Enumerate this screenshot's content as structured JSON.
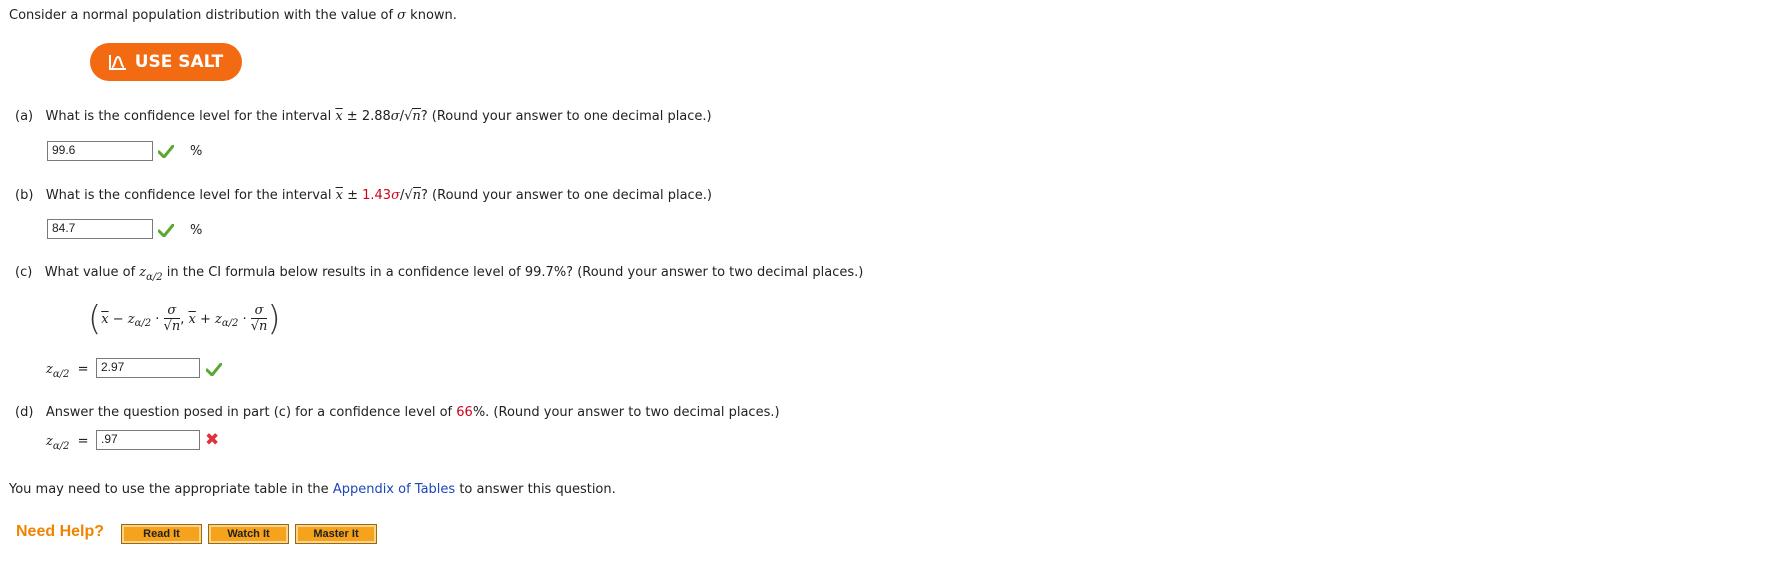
{
  "intro": {
    "prefix": "Consider a normal population distribution with the value of ",
    "sigma": "σ",
    "suffix": " known."
  },
  "salt_button": {
    "label": "USE SALT",
    "color": "#f26a12"
  },
  "part_a": {
    "label": "(a)",
    "q_prefix": "What is the confidence level for the interval ",
    "xbar": "x",
    "pm": " ± ",
    "coef": "2.88",
    "sigma": "σ",
    "slash": "/",
    "sqrt_sym": "√",
    "n": "n",
    "q_suffix": "? (Round your answer to one decimal place.)",
    "answer": "99.6",
    "unit": "%"
  },
  "part_b": {
    "label": "(b)",
    "q_prefix": "What is the confidence level for the interval ",
    "xbar": "x",
    "pm": " ± ",
    "coef": "1.43",
    "sigma": "σ",
    "slash": "/",
    "sqrt_sym": "√",
    "n": "n",
    "q_suffix": "? (Round your answer to one decimal place.)",
    "answer": "84.7",
    "unit": "%"
  },
  "part_c": {
    "label": "(c)",
    "q_prefix": "What value of ",
    "z": "z",
    "z_sub": "α/2",
    "q_suffix": " in the CI formula below results in a confidence level of 99.7%? (Round your answer to two decimal places.)",
    "formula": {
      "open": "(",
      "close": ")",
      "xbar": "x",
      "minus": " − ",
      "plus": " + ",
      "z": "z",
      "z_sub": "α/2",
      "dot": " · ",
      "sigma": "σ",
      "sqrt_sym": "√",
      "n": "n",
      "comma": ", "
    },
    "answer_label_z": "z",
    "answer_label_sub": "α/2",
    "equals": "=",
    "answer": "2.97"
  },
  "part_d": {
    "label": "(d)",
    "q_prefix": "Answer the question posed in part (c) for a confidence level of ",
    "level": "66",
    "q_suffix": "%. (Round your answer to two decimal places.)",
    "answer_label_z": "z",
    "answer_label_sub": "α/2",
    "equals": "=",
    "answer": ".97"
  },
  "footer": {
    "prefix": "You may need to use the appropriate table in the ",
    "link": "Appendix of Tables",
    "suffix": " to answer this question."
  },
  "help": {
    "title": "Need Help?",
    "buttons": [
      "Read It",
      "Watch It",
      "Master It"
    ]
  },
  "colors": {
    "accent_red": "#d0021b",
    "link": "#1c47b8",
    "check": "#5aa832",
    "help": "#f08400"
  }
}
